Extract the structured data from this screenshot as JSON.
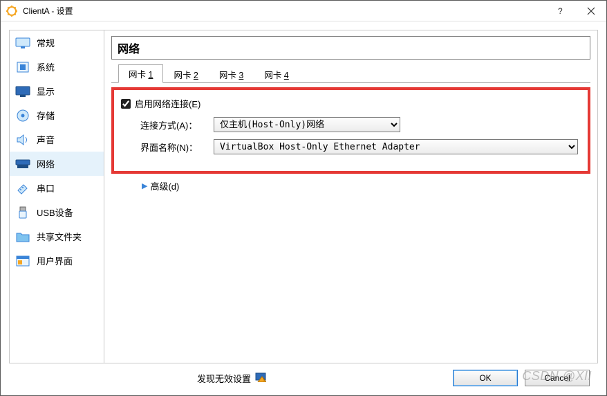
{
  "window": {
    "title": "ClientA - 设置"
  },
  "sidebar": {
    "items": [
      {
        "label": "常规"
      },
      {
        "label": "系统"
      },
      {
        "label": "显示"
      },
      {
        "label": "存储"
      },
      {
        "label": "声音"
      },
      {
        "label": "网络"
      },
      {
        "label": "串口"
      },
      {
        "label": "USB设备"
      },
      {
        "label": "共享文件夹"
      },
      {
        "label": "用户界面"
      }
    ]
  },
  "content": {
    "heading": "网络",
    "tabs": [
      {
        "prefix": "网卡 ",
        "num": "1"
      },
      {
        "prefix": "网卡 ",
        "num": "2"
      },
      {
        "prefix": "网卡 ",
        "num": "3"
      },
      {
        "prefix": "网卡 ",
        "num": "4"
      }
    ],
    "enable_label": "启用网络连接(E)",
    "attach_label": "连接方式(A)：",
    "attach_value": "仅主机(Host-Only)网络",
    "iface_label": "界面名称(N)：",
    "iface_value": "VirtualBox Host-Only Ethernet Adapter",
    "advanced_label": "高级(d)"
  },
  "footer": {
    "status_text": "发现无效设置",
    "ok": "OK",
    "cancel": "Cancel"
  },
  "watermark": "CSDN @XII"
}
